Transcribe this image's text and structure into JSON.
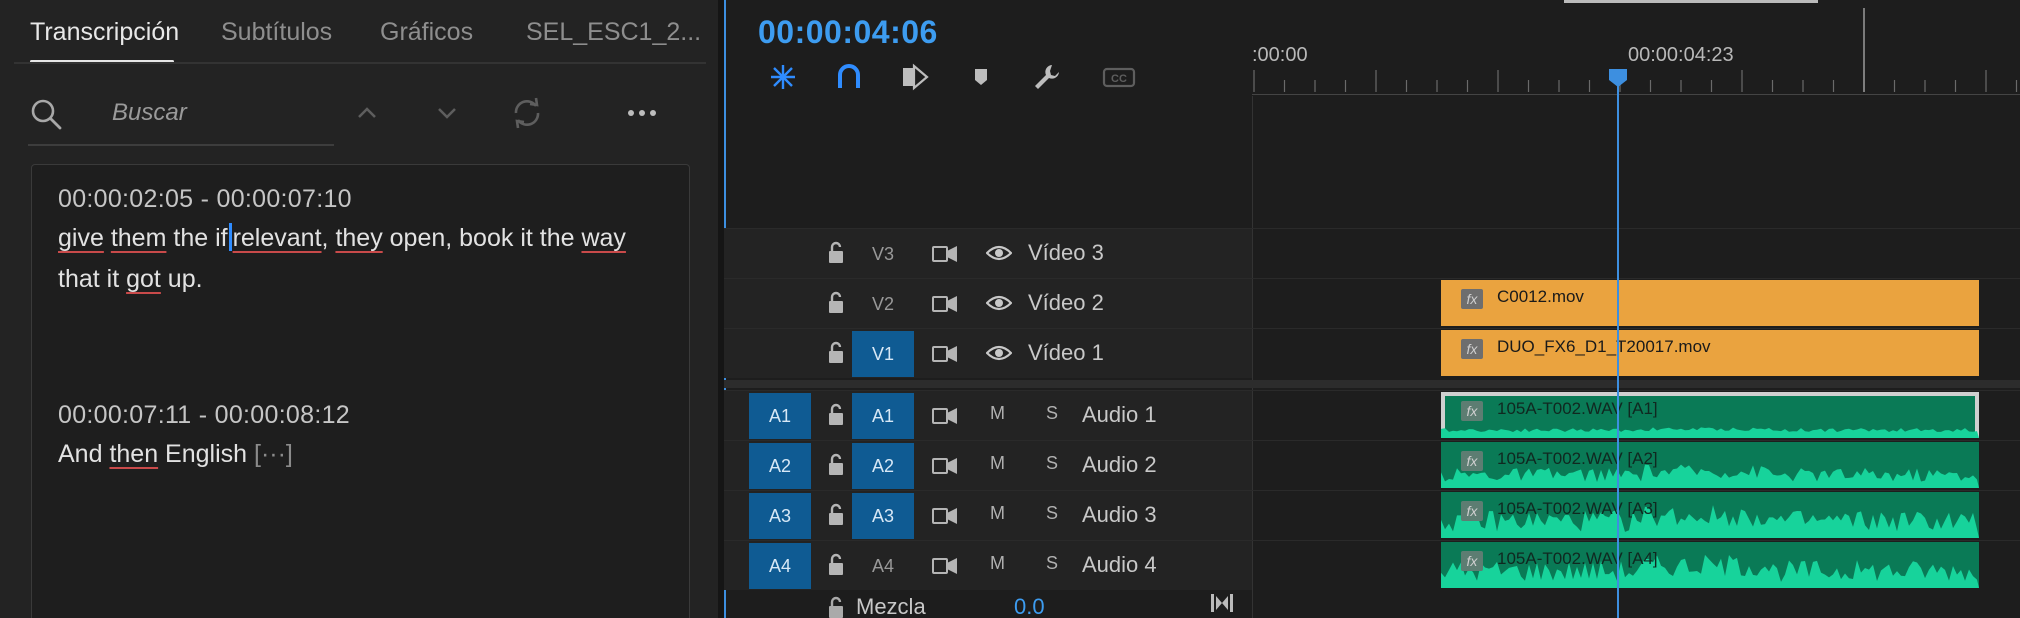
{
  "left_panel": {
    "tabs": [
      "Transcripción",
      "Subtítulos",
      "Gráficos",
      "SEL_ESC1_2..."
    ],
    "active_tab": 0,
    "search": {
      "placeholder": "Buscar"
    },
    "segments": [
      {
        "time": "00:00:02:05 - 00:00:07:10",
        "line1": [
          {
            "t": "give",
            "u": true
          },
          {
            "t": " "
          },
          {
            "t": "them",
            "u": true
          },
          {
            "t": " the if"
          },
          {
            "cursor": true
          },
          {
            "t": "relevant",
            "u": true
          },
          {
            "t": ", "
          },
          {
            "t": "they",
            "u": true
          },
          {
            "t": " open, book it the "
          },
          {
            "t": "way",
            "u": true
          }
        ],
        "line2": [
          {
            "t": "that it "
          },
          {
            "t": "got",
            "u": true
          },
          {
            "t": " up."
          }
        ]
      },
      {
        "time": "00:00:07:11 - 00:00:08:12",
        "line1": [
          {
            "t": "And "
          },
          {
            "t": "then",
            "u": true
          },
          {
            "t": " English "
          },
          {
            "t": "[···]",
            "e": true
          }
        ]
      }
    ]
  },
  "timeline": {
    "timecode": "00:00:04:06",
    "ruler_labels": [
      ":00:00",
      "00:00:04:23"
    ],
    "tracks": [
      {
        "id": "v3",
        "target": "V3",
        "target_on": false,
        "name": "Vídeo 3",
        "kind": "video"
      },
      {
        "id": "v2",
        "target": "V2",
        "target_on": false,
        "name": "Vídeo 2",
        "kind": "video"
      },
      {
        "id": "v1",
        "target": "V1",
        "target_on": true,
        "name": "Vídeo 1",
        "kind": "video"
      },
      {
        "id": "a1",
        "source": "A1",
        "target": "A1",
        "target_on": true,
        "name": "Audio 1",
        "kind": "audio",
        "m": "M",
        "s": "S"
      },
      {
        "id": "a2",
        "source": "A2",
        "target": "A2",
        "target_on": true,
        "name": "Audio 2",
        "kind": "audio",
        "m": "M",
        "s": "S"
      },
      {
        "id": "a3",
        "source": "A3",
        "target": "A3",
        "target_on": true,
        "name": "Audio 3",
        "kind": "audio",
        "m": "M",
        "s": "S"
      },
      {
        "id": "a4",
        "source": "A4",
        "target": "A4",
        "target_on": false,
        "name": "Audio 4",
        "kind": "audio",
        "m": "M",
        "s": "S"
      }
    ],
    "clips": [
      {
        "track": "v2",
        "name": "C0012.mov",
        "fx": "fx"
      },
      {
        "track": "v1",
        "name": "DUO_FX6_D1_T20017.mov",
        "fx": "fx"
      },
      {
        "track": "a1",
        "name": "105A-T002.WAV [A1]",
        "fx": "fx",
        "selected": true
      },
      {
        "track": "a2",
        "name": "105A-T002.WAV [A2]",
        "fx": "fx"
      },
      {
        "track": "a3",
        "name": "105A-T002.WAV [A3]",
        "fx": "fx"
      },
      {
        "track": "a4",
        "name": "105A-T002.WAV [A4]",
        "fx": "fx"
      }
    ],
    "mix": {
      "label": "Mezcla",
      "value": "0.0"
    }
  },
  "colors": {
    "accent": "#3d9cf0",
    "video_clip": "#eaa33f",
    "audio_clip": "#0a7a56",
    "target_on": "#0f5b93"
  }
}
